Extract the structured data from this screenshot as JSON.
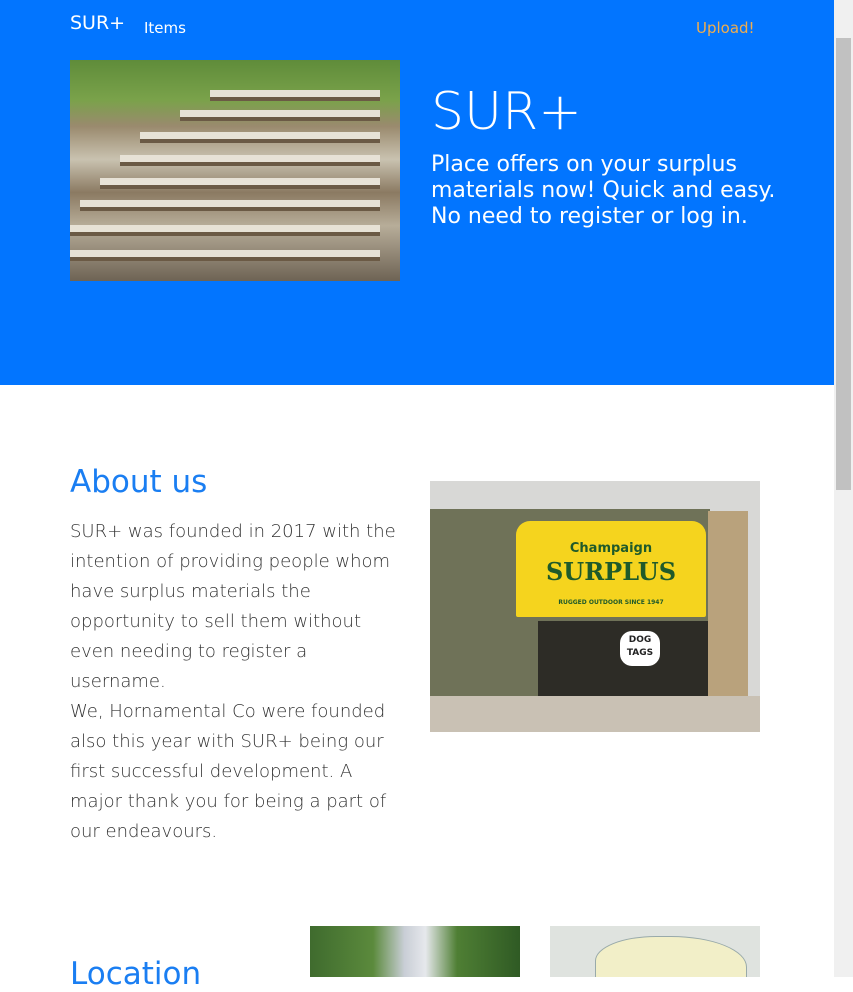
{
  "nav": {
    "brand": "SUR+",
    "items_label": "Items",
    "upload_label": "Upload!"
  },
  "hero": {
    "title": "SUR+",
    "tagline": "Place offers on your surplus materials now! Quick and easy. No need to register or log in."
  },
  "about": {
    "title": "About us",
    "paragraph1": "SUR+ was founded in 2017 with the intention of providing people whom have surplus materials the opportunity to sell them without even needing to register a username.",
    "paragraph2": "We, Hornamental Co were founded also this year with SUR+ being our first successful development. A major thank you for being a part of our endeavours.",
    "store_sign": {
      "small": "Champaign",
      "big": "SURPLUS",
      "tagline": "RUGGED OUTDOOR SINCE 1947",
      "window_sign": "DOG TAGS"
    }
  },
  "location": {
    "title": "Location"
  },
  "colors": {
    "hero_bg": "#0275ff",
    "heading": "#1a7ef2",
    "upload_link": "#f0ad4e"
  }
}
